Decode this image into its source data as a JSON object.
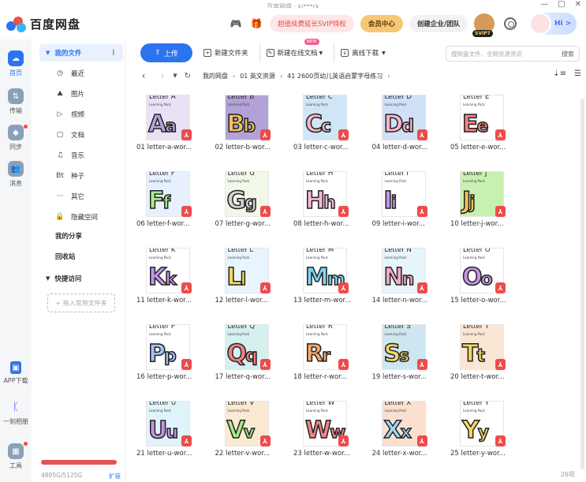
{
  "window": {
    "title": "百度网盘 · ki***rk",
    "controls": [
      "—",
      "□",
      "✕"
    ]
  },
  "header": {
    "logo_text": "百度网盘",
    "svip_promo": "超值续费延长SVIP特权",
    "vip_center": "会员中心",
    "enterprise": "创建企业/团队",
    "svip_badge": "SVIP7",
    "hi_text": "Hi >"
  },
  "rail": {
    "items": [
      {
        "label": "首页",
        "icon": "cloud-icon",
        "color": "#2b74f1"
      },
      {
        "label": "传输",
        "icon": "transfer-icon",
        "color": "#8aa0b8"
      },
      {
        "label": "同步",
        "icon": "sync-icon",
        "color": "#8aa0b8"
      },
      {
        "label": "消息",
        "icon": "message-icon",
        "color": "#8aa0b8"
      }
    ],
    "bottom": [
      {
        "label": "APP下载",
        "icon": "app-download-icon"
      },
      {
        "label": "一刻相册",
        "icon": "album-icon"
      },
      {
        "label": "工具",
        "icon": "tools-icon"
      }
    ]
  },
  "sidebar": {
    "my_files": "我的文件",
    "items": [
      {
        "label": "最近",
        "icon": "clock-icon",
        "glyph": "◷"
      },
      {
        "label": "图片",
        "icon": "image-icon",
        "glyph": "⛰"
      },
      {
        "label": "视频",
        "icon": "video-icon",
        "glyph": "▷"
      },
      {
        "label": "文档",
        "icon": "document-icon",
        "glyph": "▢"
      },
      {
        "label": "音乐",
        "icon": "music-icon",
        "glyph": "♫"
      },
      {
        "label": "种子",
        "icon": "bt-icon",
        "glyph": "Bt"
      },
      {
        "label": "其它",
        "icon": "more-icon",
        "glyph": "···"
      },
      {
        "label": "隐藏空间",
        "icon": "lock-icon",
        "glyph": "🔒"
      }
    ],
    "my_share": "我的分享",
    "recycle": "回收站",
    "quick_access": "快捷访问",
    "quick_add": "+ 拖入常用文件夹",
    "storage_text": "4805G/5125G",
    "storage_used_fraction": 0.9376,
    "expand": "扩容"
  },
  "toolbar": {
    "upload": "上传",
    "new_folder": "新建文件夹",
    "new_online_doc": "新建在线文档",
    "new_badge": "NEW",
    "offline_download": "离线下载",
    "search_placeholder": "搜网盘文件、全网资源资讯",
    "search_btn": "搜索"
  },
  "path": {
    "crumbs": [
      "我的网盘",
      "01 英文资源",
      "41 2600页幼儿英语启蒙字母练习"
    ]
  },
  "files": [
    {
      "name": "01 letter-a-wor...",
      "header": "Letter A",
      "upper": "A",
      "lower": "a",
      "color": "#b6a3d9",
      "bg": "#e9e2f6"
    },
    {
      "name": "02 letter-b-wor...",
      "header": "Letter B",
      "upper": "B",
      "lower": "b",
      "color": "#f0c35a",
      "bg": "#b3a2d8"
    },
    {
      "name": "03 letter-c-wor...",
      "header": "Letter C",
      "upper": "C",
      "lower": "c",
      "color": "#f7b7c9",
      "bg": "#cfe6f7"
    },
    {
      "name": "04 letter-d-wor...",
      "header": "Letter D",
      "upper": "D",
      "lower": "d",
      "color": "#f7b7c9",
      "bg": "#cfe0f7"
    },
    {
      "name": "05 letter-e-wor...",
      "header": "Letter E",
      "upper": "E",
      "lower": "e",
      "color": "#f08383",
      "bg": "#ffffff"
    },
    {
      "name": "06 letter-f-wor...",
      "header": "Letter F",
      "upper": "F",
      "lower": "f",
      "color": "#a6ee86",
      "bg": "#e6f0ff"
    },
    {
      "name": "07 letter-g-wor...",
      "header": "Letter G",
      "upper": "G",
      "lower": "g",
      "color": "#d3d3d3",
      "bg": "#f1f8e8"
    },
    {
      "name": "08 letter-h-wor...",
      "header": "Letter H",
      "upper": "H",
      "lower": "h",
      "color": "#f5b8d8",
      "bg": "#ffffff"
    },
    {
      "name": "09 letter-i-wor...",
      "header": "Letter I",
      "upper": "I",
      "lower": "i",
      "color": "#c393e8",
      "bg": "#ffffff"
    },
    {
      "name": "10 letter-j-wor...",
      "header": "Letter J",
      "upper": "J",
      "lower": "j",
      "color": "#f0c35a",
      "bg": "#c8f0b0"
    },
    {
      "name": "11 letter-k-wor...",
      "header": "Letter K",
      "upper": "K",
      "lower": "k",
      "color": "#c393e8",
      "bg": "#ffffff"
    },
    {
      "name": "12 letter-l-wor...",
      "header": "Letter L",
      "upper": "L",
      "lower": "l",
      "color": "#f6d860",
      "bg": "#e8f4ff"
    },
    {
      "name": "13 letter-m-wor...",
      "header": "Letter M",
      "upper": "M",
      "lower": "m",
      "color": "#7fd4f0",
      "bg": "#ffffff"
    },
    {
      "name": "14 letter-n-wor...",
      "header": "Letter N",
      "upper": "N",
      "lower": "n",
      "color": "#f5a8c8",
      "bg": "#e6f5f9"
    },
    {
      "name": "15 letter-o-wor...",
      "header": "Letter O",
      "upper": "O",
      "lower": "o",
      "color": "#c393e8",
      "bg": "#ffffff"
    },
    {
      "name": "16 letter-p-wor...",
      "header": "Letter P",
      "upper": "P",
      "lower": "p",
      "color": "#9fc0f5",
      "bg": "#ffffff"
    },
    {
      "name": "17 letter-q-wor...",
      "header": "Letter Q",
      "upper": "Q",
      "lower": "q",
      "color": "#f08383",
      "bg": "#d6f0f0"
    },
    {
      "name": "18 letter-r-wor...",
      "header": "Letter R",
      "upper": "R",
      "lower": "r",
      "color": "#f5a86a",
      "bg": "#ffffff"
    },
    {
      "name": "19 letter-s-wor...",
      "header": "Letter S",
      "upper": "S",
      "lower": "s",
      "color": "#f6d860",
      "bg": "#cde6f0"
    },
    {
      "name": "20 letter-t-wor...",
      "header": "Letter T",
      "upper": "T",
      "lower": "t",
      "color": "#f6d860",
      "bg": "#fbe6d6"
    },
    {
      "name": "21 letter-u-wor...",
      "header": "Letter U",
      "upper": "U",
      "lower": "u",
      "color": "#c393e8",
      "bg": "#e0f3fb"
    },
    {
      "name": "22 letter-v-wor...",
      "header": "Letter V",
      "upper": "V",
      "lower": "v",
      "color": "#a6ee86",
      "bg": "#fbe9d2"
    },
    {
      "name": "23 letter-w-wor...",
      "header": "Letter W",
      "upper": "W",
      "lower": "w",
      "color": "#f08383",
      "bg": "#ffffff"
    },
    {
      "name": "24 letter-x-wor...",
      "header": "Letter X",
      "upper": "X",
      "lower": "x",
      "color": "#9fd7f7",
      "bg": "#fbe0d0"
    },
    {
      "name": "25 letter-y-wor...",
      "header": "Letter Y",
      "upper": "Y",
      "lower": "y",
      "color": "#f6d860",
      "bg": "#ffffff"
    }
  ],
  "count": "26项",
  "colors": {
    "accent": "#2b74f1",
    "pdf": "#f04b4b",
    "storage_bar": "#e55353"
  }
}
